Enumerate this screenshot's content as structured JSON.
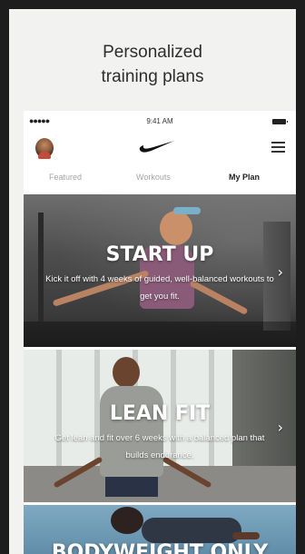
{
  "headline": {
    "line1": "Personalized",
    "line2": "training plans"
  },
  "status_bar": {
    "signal": "●●●●●",
    "time": "9:41 AM"
  },
  "nav": {
    "avatar_icon": "profile-avatar",
    "logo_icon": "nike-swoosh-logo",
    "menu_icon": "list-menu-icon"
  },
  "tabs": [
    {
      "label": "Featured",
      "active": false
    },
    {
      "label": "Workouts",
      "active": false
    },
    {
      "label": "My Plan",
      "active": true
    }
  ],
  "plans": [
    {
      "title": "START UP",
      "description": "Kick it off with 4 weeks of guided, well-balanced workouts to get you fit."
    },
    {
      "title": "LEAN FIT",
      "description": "Get lean and fit over 6 weeks with a balanced plan that builds endurance."
    },
    {
      "title": "BODYWEIGHT ONLY",
      "description": ""
    }
  ],
  "colors": {
    "background": "#1d1d1d",
    "card": "#f2f2f0",
    "text_dark": "#2e2e2e",
    "tab_inactive": "#a5a5a5",
    "tile_text": "#ffffff"
  }
}
